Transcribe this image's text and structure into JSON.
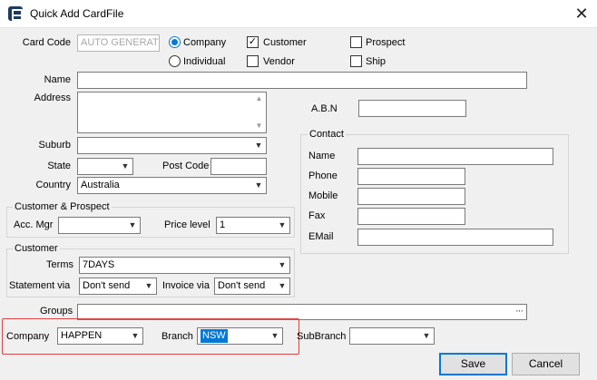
{
  "window": {
    "title": "Quick Add CardFile",
    "close_glyph": "✕"
  },
  "header": {
    "card_code_label": "Card Code",
    "card_code_value": "AUTO GENERATE",
    "company_radio_label": "Company",
    "individual_radio_label": "Individual",
    "customer_check_label": "Customer",
    "vendor_check_label": "Vendor",
    "prospect_check_label": "Prospect",
    "ship_check_label": "Ship",
    "check_mark": "✓"
  },
  "fields": {
    "name_label": "Name",
    "address_label": "Address",
    "abn_label": "A.B.N",
    "suburb_label": "Suburb",
    "state_label": "State",
    "postcode_label": "Post Code",
    "country_label": "Country",
    "country_value": "Australia"
  },
  "contact": {
    "group_title": "Contact",
    "name_label": "Name",
    "phone_label": "Phone",
    "mobile_label": "Mobile",
    "fax_label": "Fax",
    "email_label": "EMail"
  },
  "customer_prospect": {
    "group_title": "Customer & Prospect",
    "acc_mgr_label": "Acc. Mgr",
    "price_level_label": "Price level",
    "price_level_value": "1"
  },
  "customer": {
    "group_title": "Customer",
    "terms_label": "Terms",
    "terms_value": "7DAYS",
    "statement_via_label": "Statement via",
    "statement_via_value": "Don't send",
    "invoice_via_label": "Invoice via",
    "invoice_via_value": "Don't send"
  },
  "bottom": {
    "groups_label": "Groups",
    "groups_button": "···",
    "company_label": "Company",
    "company_value": "HAPPEN",
    "branch_label": "Branch",
    "branch_value": "NSW",
    "subbranch_label": "SubBranch"
  },
  "buttons": {
    "save_label": "Save",
    "cancel_label": "Cancel"
  },
  "icons": {
    "caret": "▼",
    "scroll_up": "▲",
    "scroll_down": "▼"
  },
  "colors": {
    "highlight_border": "#e03c3c",
    "selection_blue": "#0078d7"
  }
}
